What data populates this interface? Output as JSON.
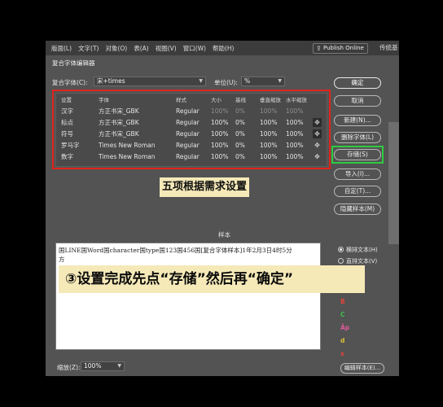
{
  "menubar": {
    "items": [
      "版面(L)",
      "文字(T)",
      "对象(O)",
      "表(A)",
      "视图(V)",
      "窗口(W)",
      "帮助(H)"
    ],
    "publish_label": "Publish Online",
    "right_text": "传统基"
  },
  "dialog": {
    "title": "复合字体编辑器",
    "composite_font_label": "复合字体(C):",
    "composite_font_value": "宋+times",
    "unit_label": "单位(U):",
    "unit_value": "%"
  },
  "table": {
    "headers": [
      "设置",
      "字体",
      "",
      "样式",
      "大小",
      "基线",
      "垂直缩放",
      "水平缩放"
    ],
    "rows": [
      {
        "setting": "汉字",
        "font": "方正书宋_GBK",
        "style": "Regular",
        "size": "100%",
        "baseline": "0%",
        "vscale": "100%",
        "hscale": "100%"
      },
      {
        "setting": "标点",
        "font": "方正书宋_GBK",
        "style": "Regular",
        "size": "100%",
        "baseline": "0%",
        "vscale": "100%",
        "hscale": "100%"
      },
      {
        "setting": "符号",
        "font": "方正书宋_GBK",
        "style": "Regular",
        "size": "100%",
        "baseline": "0%",
        "vscale": "100%",
        "hscale": "100%"
      },
      {
        "setting": "罗马字",
        "font": "Times New Roman",
        "style": "Regular",
        "size": "100%",
        "baseline": "0%",
        "vscale": "100%",
        "hscale": "100%"
      },
      {
        "setting": "数字",
        "font": "Times New Roman",
        "style": "Regular",
        "size": "100%",
        "baseline": "0%",
        "vscale": "100%",
        "hscale": "100%"
      }
    ]
  },
  "buttons": {
    "ok": "确定",
    "cancel": "取消",
    "new": "新建(N)...",
    "delete_font": "删除字体(L)",
    "save": "存储(S)",
    "import": "导入(I)...",
    "custom": "自定(T)...",
    "hide_sample": "隐藏样本(M)",
    "edit_sample": "编辑样本(E)..."
  },
  "annotations": {
    "banner_top": "五项根据需求设置",
    "banner_bottom": "③设置完成先点“存储”然后再“确定”"
  },
  "sample": {
    "label": "样本",
    "line1": "国LINE国Word国character国type国123国456国[复合字体样本]1年2月3日4时5分",
    "line2": "方"
  },
  "sample_options": {
    "horizontal": "横排文本(H)",
    "vertical": "直排文本(V)"
  },
  "guide_letters": [
    {
      "text": "B",
      "color": "#e0443a"
    },
    {
      "text": "C",
      "color": "#3fbf4a"
    },
    {
      "text": "Āp",
      "color": "#e05a9a"
    },
    {
      "text": "d",
      "color": "#d9c236"
    },
    {
      "text": "x",
      "color": "#e0443a"
    }
  ],
  "zoom": {
    "label": "缩放(Z):",
    "value": "100%"
  }
}
